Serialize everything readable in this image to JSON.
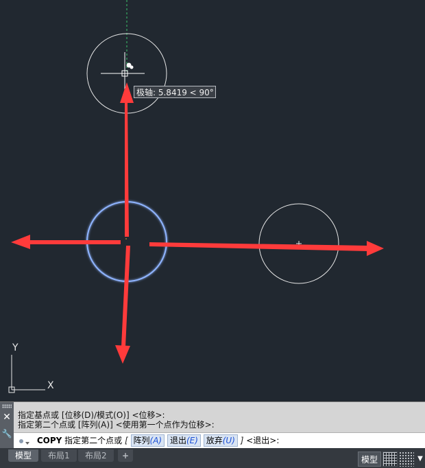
{
  "tooltip": {
    "text": "极轴: 5.8419 < 90°"
  },
  "ucs": {
    "y_label": "Y",
    "x_label": "X"
  },
  "command_history": [
    "指定基点或 [位移(D)/模式(O)] <位移>:",
    "指定第二个点或 [阵列(A)] <使用第一个点作为位移>:"
  ],
  "command_line": {
    "command": "COPY",
    "prompt": "指定第二个点或",
    "bracket_open": "[",
    "options": [
      {
        "label": "阵列",
        "key": "(A)"
      },
      {
        "label": "退出",
        "key": "(E)"
      },
      {
        "label": "放弃",
        "key": "(U)"
      }
    ],
    "bracket_close": "]",
    "default": "<退出>:"
  },
  "side_buttons": {
    "close": "✕",
    "tool": "🔧"
  },
  "layout_tabs": [
    {
      "label": "模型",
      "active": true
    },
    {
      "label": "布局1",
      "active": false
    },
    {
      "label": "布局2",
      "active": false
    }
  ],
  "add_tab": "+",
  "status_bar": {
    "model_label": "模型",
    "dropdown": "▼"
  },
  "colors": {
    "background": "#212830",
    "arrow": "#ff3b3b",
    "selected_circle": "#8fb4ff",
    "polar_track": "#3cc46b"
  }
}
